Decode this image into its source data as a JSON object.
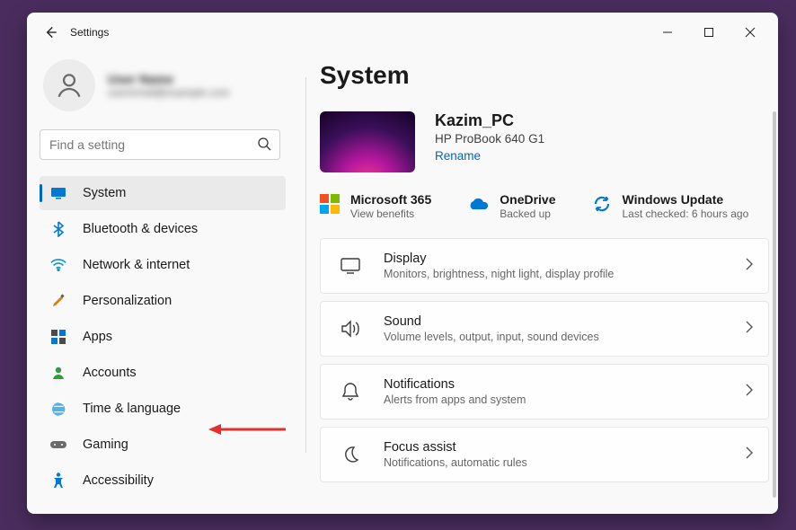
{
  "app_title": "Settings",
  "profile": {
    "name": "User Name",
    "sub": "useremail@example.com"
  },
  "search": {
    "placeholder": "Find a setting"
  },
  "nav": [
    {
      "key": "system",
      "label": "System"
    },
    {
      "key": "bluetooth",
      "label": "Bluetooth & devices"
    },
    {
      "key": "network",
      "label": "Network & internet"
    },
    {
      "key": "personal",
      "label": "Personalization"
    },
    {
      "key": "apps",
      "label": "Apps"
    },
    {
      "key": "accounts",
      "label": "Accounts"
    },
    {
      "key": "time",
      "label": "Time & language"
    },
    {
      "key": "gaming",
      "label": "Gaming"
    },
    {
      "key": "access",
      "label": "Accessibility"
    }
  ],
  "page": {
    "title": "System"
  },
  "device": {
    "name": "Kazim_PC",
    "model": "HP ProBook 640 G1",
    "rename": "Rename"
  },
  "chips": {
    "m365": {
      "title": "Microsoft 365",
      "sub": "View benefits"
    },
    "onedrive": {
      "title": "OneDrive",
      "sub": "Backed up"
    },
    "update": {
      "title": "Windows Update",
      "sub": "Last checked: 6 hours ago"
    }
  },
  "cards": [
    {
      "key": "display",
      "title": "Display",
      "sub": "Monitors, brightness, night light, display profile"
    },
    {
      "key": "sound",
      "title": "Sound",
      "sub": "Volume levels, output, input, sound devices"
    },
    {
      "key": "notif",
      "title": "Notifications",
      "sub": "Alerts from apps and system"
    },
    {
      "key": "focus",
      "title": "Focus assist",
      "sub": "Notifications, automatic rules"
    }
  ]
}
